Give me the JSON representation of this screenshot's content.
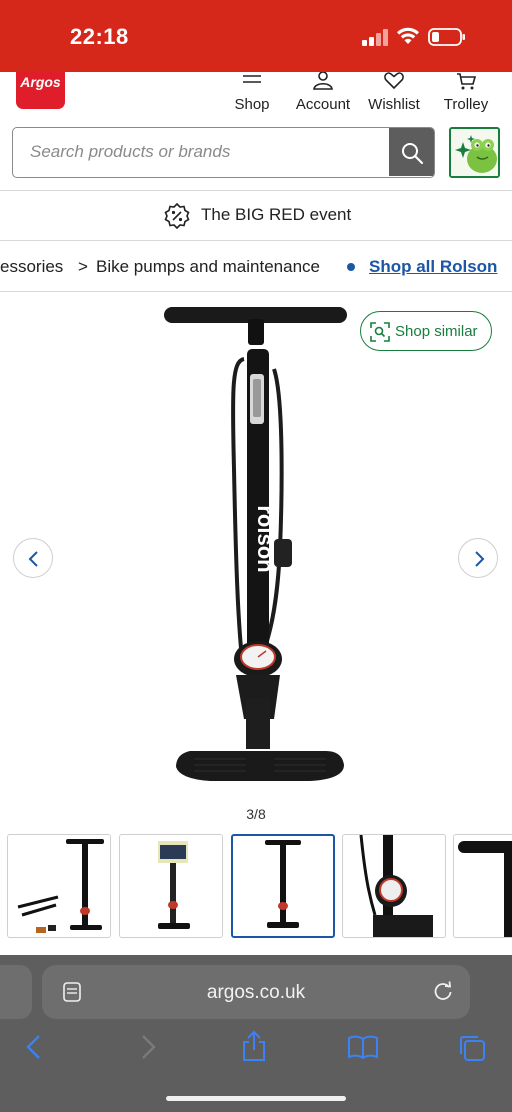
{
  "status_bar": {
    "time": "22:18"
  },
  "header": {
    "logo_text": "Argos",
    "nav": [
      {
        "label": "Shop",
        "icon": "menu-icon"
      },
      {
        "label": "Account",
        "icon": "person-icon"
      },
      {
        "label": "Wishlist",
        "icon": "heart-icon"
      },
      {
        "label": "Trolley",
        "icon": "trolley-icon"
      }
    ]
  },
  "search": {
    "placeholder": "Search products or brands"
  },
  "promo": {
    "text": "The BIG RED event"
  },
  "breadcrumb": {
    "partial": "essories",
    "separator": ">",
    "current": "Bike pumps and maintenance",
    "brand_link": "Shop all Rolson"
  },
  "gallery": {
    "shop_similar_label": "Shop similar",
    "brand_on_product": "rolson",
    "counter": "3/8",
    "current_index": 3,
    "total": 8
  },
  "browser": {
    "url": "argos.co.uk"
  },
  "colors": {
    "status_bar": "#d5281b",
    "argos_red": "#e01e2b",
    "accent_green": "#187e3d",
    "link_blue": "#1c56a6",
    "browser_chrome": "#5e5e5e"
  }
}
